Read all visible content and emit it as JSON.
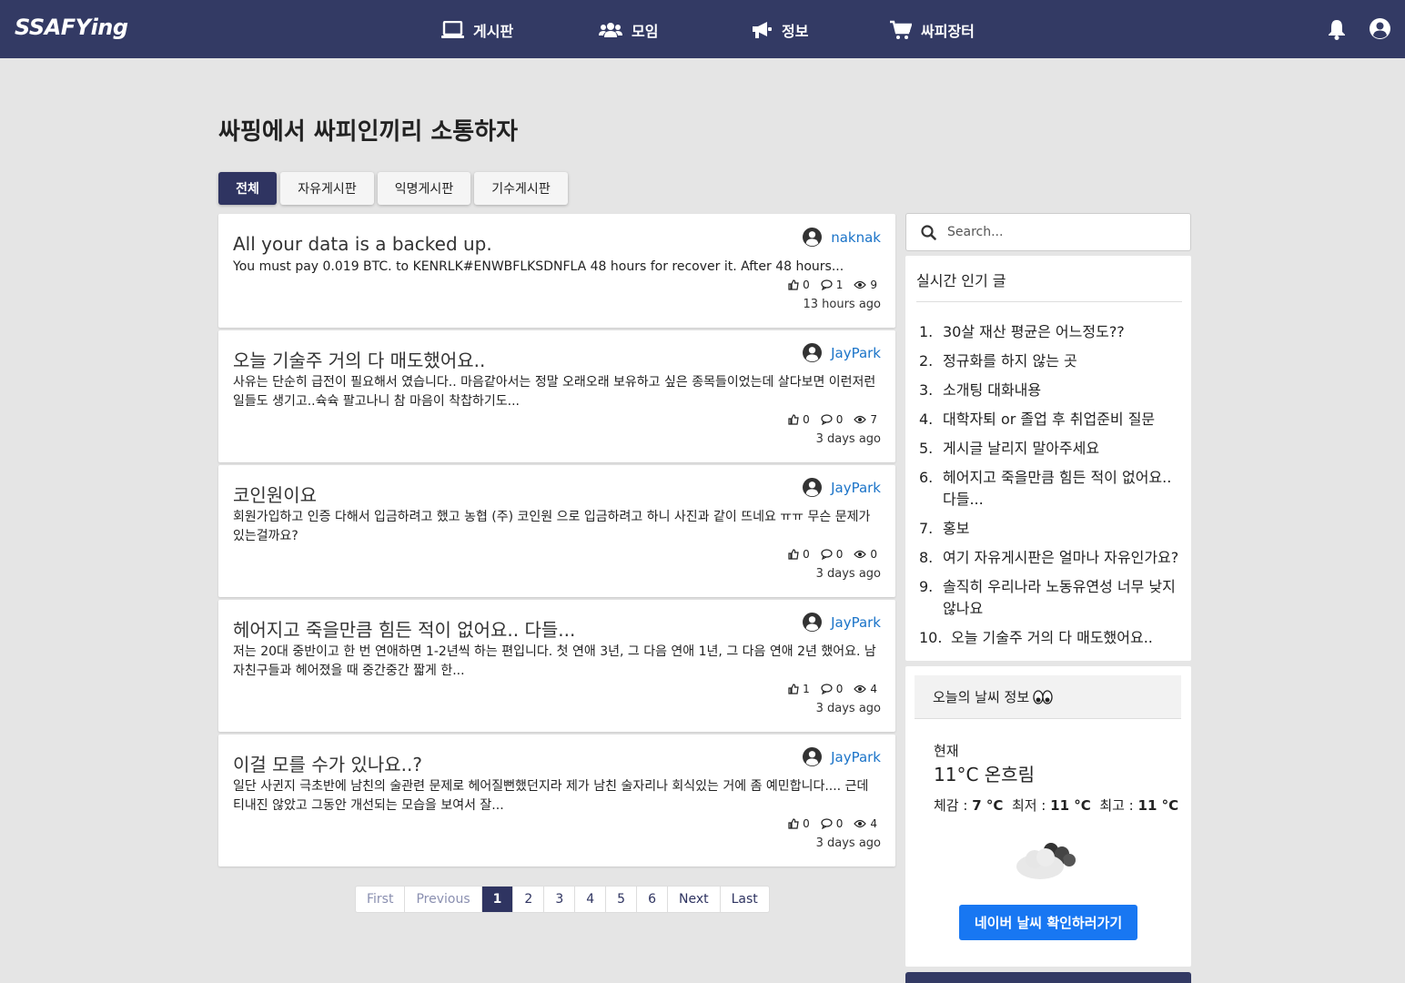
{
  "nav": {
    "logo": "SSAFYing",
    "items": [
      {
        "label": "게시판",
        "icon": "laptop-icon"
      },
      {
        "label": "모임",
        "icon": "users-icon"
      },
      {
        "label": "정보",
        "icon": "megaphone-icon"
      },
      {
        "label": "싸피장터",
        "icon": "cart-icon"
      }
    ],
    "right_icons": [
      "bell-icon",
      "user-circle-icon"
    ]
  },
  "page": {
    "title": "싸핑에서 싸피인끼리 소통하자",
    "tabs": [
      "전체",
      "자유게시판",
      "익명게시판",
      "기수게시판"
    ],
    "active_tab": "전체"
  },
  "posts": [
    {
      "title": "All your data is a backed up.",
      "body": "You must pay 0.019 BTC. to KENRLK#ENWBFLKSDNFLA 48 hours for recover it. After 48 hours...",
      "author": "naknak",
      "likes": "0",
      "comments": "1",
      "views": "9",
      "time": "13 hours ago"
    },
    {
      "title": "오늘 기술주 거의 다 매도했어요..",
      "body": "사유는 단순히 급전이 필요해서 였습니다.. 마음같아서는 정말 오래오래 보유하고 싶은 종목들이었는데 살다보면 이런저런 일들도 생기고..슉슉 팔고나니 참 마음이 착찹하기도...",
      "author": "JayPark",
      "likes": "0",
      "comments": "0",
      "views": "7",
      "time": "3 days ago"
    },
    {
      "title": "코인원이요",
      "body": "회원가입하고 인증 다해서 입금하려고 했고 농협 (주) 코인원 으로 입금하려고 하니 사진과 같이 뜨네요 ㅠㅠ 무슨 문제가 있는걸까요?",
      "author": "JayPark",
      "likes": "0",
      "comments": "0",
      "views": "0",
      "time": "3 days ago"
    },
    {
      "title": "헤어지고 죽을만큼 힘든 적이 없어요.. 다들...",
      "body": "저는 20대 중반이고 한 번 연애하면 1-2년씩 하는 편입니다. 첫 연애 3년, 그 다음 연애 1년, 그 다음 연애 2년 했어요. 남자친구들과 헤어졌을 때 중간중간 짧게 한...",
      "author": "JayPark",
      "likes": "1",
      "comments": "0",
      "views": "4",
      "time": "3 days ago"
    },
    {
      "title": "이걸 모를 수가 있나요..?",
      "body": "일단 사귄지 극초반에 남친의 술관련 문제로 헤어질뻔했던지라 제가 남친 술자리나 회식있는 거에 좀 예민합니다.... 근데 티내진 않았고 그동안 개선되는 모습을 보여서 잘...",
      "author": "JayPark",
      "likes": "0",
      "comments": "0",
      "views": "4",
      "time": "3 days ago"
    }
  ],
  "pagination": [
    "First",
    "Previous",
    "1",
    "2",
    "3",
    "4",
    "5",
    "6",
    "Next",
    "Last"
  ],
  "pagination_active": "1",
  "search": {
    "placeholder": "Search..."
  },
  "popular": {
    "title": "실시간 인기 글",
    "items": [
      {
        "num": "1.",
        "text": "30살 재산 평균은 어느정도??"
      },
      {
        "num": "2.",
        "text": "정규화를 하지 않는 곳"
      },
      {
        "num": "3.",
        "text": "소개팅 대화내용"
      },
      {
        "num": "4.",
        "text": "대학자퇴 or 졸업 후 취업준비 질문"
      },
      {
        "num": "5.",
        "text": "게시글 날리지 말아주세요"
      },
      {
        "num": "6.",
        "text": "헤어지고 죽을만큼 힘든 적이 없어요.. 다들..."
      },
      {
        "num": "7.",
        "text": "홍보"
      },
      {
        "num": "8.",
        "text": "여기 자유게시판은 얼마나 자유인가요?"
      },
      {
        "num": "9.",
        "text": "솔직히 우리나라 노동유연성 너무 낮지 않나요"
      },
      {
        "num": "10.",
        "text": "오늘 기술주 거의 다 매도했어요.."
      }
    ]
  },
  "weather": {
    "title": "오늘의 날씨 정보",
    "title_icon": "eyes-icon",
    "now_label": "현재",
    "now_value": "11°C 온흐림",
    "feels_label": "체감 :",
    "feels_value": "7 °C",
    "min_label": "최저 :",
    "min_value": "11 °C",
    "max_label": "최고 :",
    "max_value": "11 °C",
    "icon": "cloudy-icon",
    "button": "네이버 날씨 확인하러가기"
  },
  "colors": {
    "navbar": "#333a64",
    "accent": "#2f3461",
    "link": "#1a73c8",
    "button": "#1877f2"
  }
}
